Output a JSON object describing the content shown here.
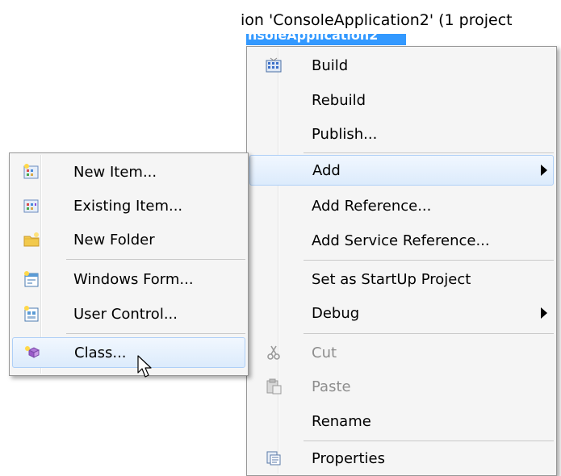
{
  "solution_explorer": {
    "title_text": "ion 'ConsoleApplication2' (1 project",
    "project_node_text": "nsoleApplication2"
  },
  "context_menu": {
    "items": [
      {
        "label": "Build",
        "icon": "build-icon",
        "enabled": true
      },
      {
        "label": "Rebuild",
        "enabled": true
      },
      {
        "label": "Publish...",
        "enabled": true
      },
      {
        "label": "Add",
        "enabled": true,
        "submenu": true,
        "highlighted": true
      },
      {
        "label": "Add Reference...",
        "enabled": true
      },
      {
        "label": "Add Service Reference...",
        "enabled": true
      },
      {
        "label": "Set as StartUp Project",
        "enabled": true
      },
      {
        "label": "Debug",
        "enabled": true,
        "submenu": true
      },
      {
        "label": "Cut",
        "icon": "scissors-icon",
        "enabled": false
      },
      {
        "label": "Paste",
        "icon": "paste-icon",
        "enabled": false
      },
      {
        "label": "Rename",
        "enabled": true
      },
      {
        "label": "Properties",
        "icon": "properties-icon",
        "enabled": true
      }
    ]
  },
  "add_submenu": {
    "items": [
      {
        "label": "New Item...",
        "icon": "new-item-icon"
      },
      {
        "label": "Existing Item...",
        "icon": "existing-item-icon"
      },
      {
        "label": "New Folder",
        "icon": "new-folder-icon"
      },
      {
        "label": "Windows Form...",
        "icon": "windows-form-icon"
      },
      {
        "label": "User Control...",
        "icon": "user-control-icon"
      },
      {
        "label": "Class...",
        "icon": "class-icon",
        "highlighted": true
      }
    ]
  },
  "colors": {
    "menu_background": "#f5f5f5",
    "menu_border": "#979797",
    "highlight_border": "#aecff7",
    "selection_blue": "#3399ff",
    "disabled_text": "#8d8d8d"
  }
}
